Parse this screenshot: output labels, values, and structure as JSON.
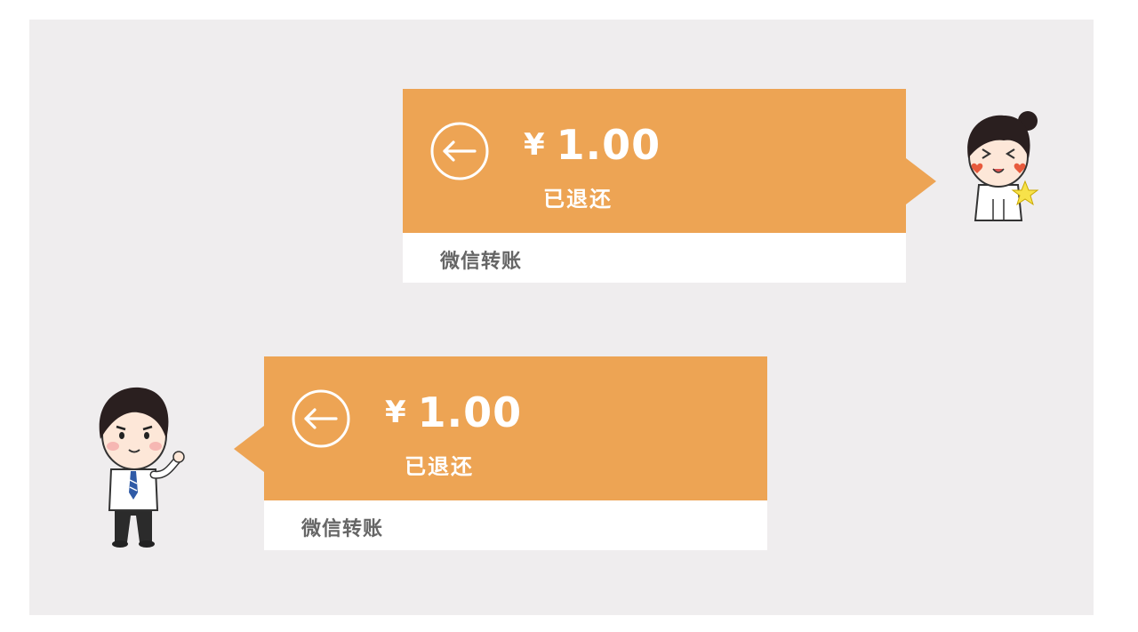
{
  "colors": {
    "accent": "#eda454",
    "background": "#efedee",
    "footer": "#ffffff",
    "footer_text": "#666666"
  },
  "messages": [
    {
      "sender": "right",
      "icon": "return-arrow-icon",
      "currency": "¥",
      "amount": "1.00",
      "status": "已退还",
      "source": "微信转账",
      "avatar": "avatar-girl-icon"
    },
    {
      "sender": "left",
      "icon": "return-arrow-icon",
      "currency": "¥",
      "amount": "1.00",
      "status": "已退还",
      "source": "微信转账",
      "avatar": "avatar-boy-icon"
    }
  ]
}
